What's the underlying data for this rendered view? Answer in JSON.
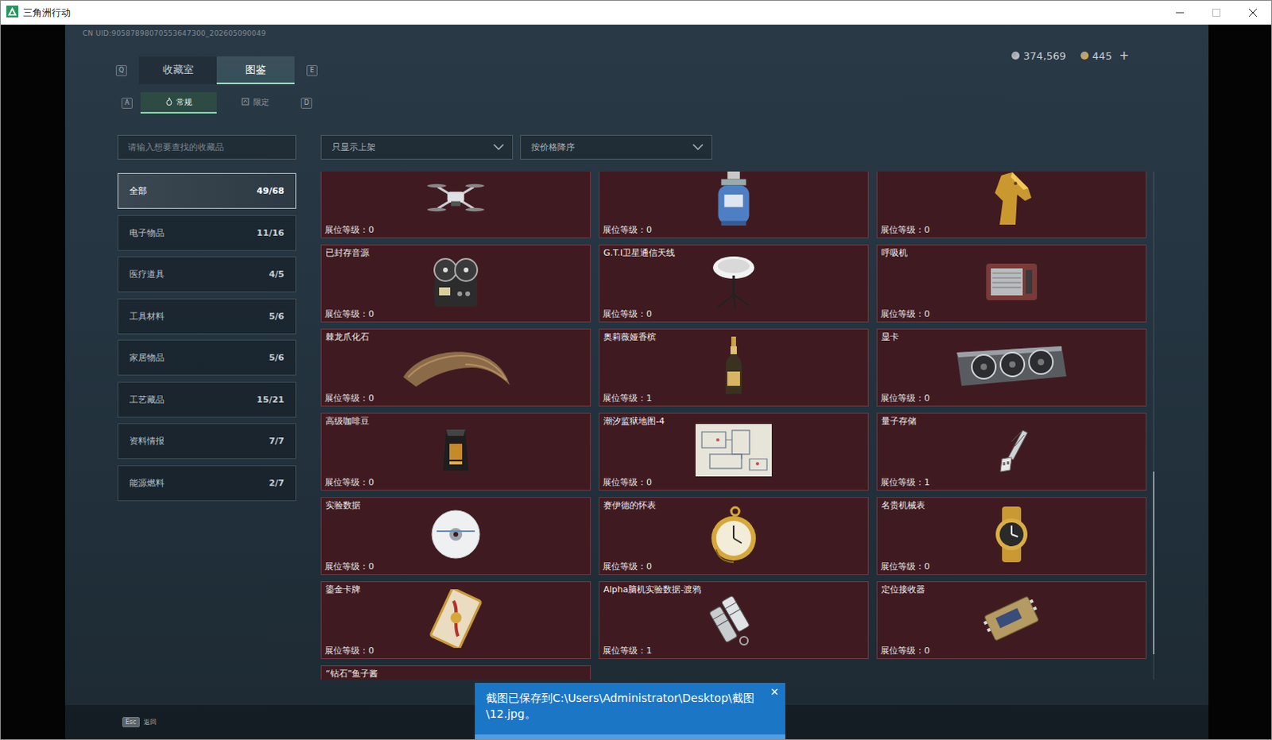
{
  "window": {
    "title": "三角洲行动"
  },
  "uid": "CN UID:90587898070553647300_202605090049",
  "currency": [
    {
      "amount": "374,569",
      "color": "#b9bec2"
    },
    {
      "amount": "445",
      "color": "#d8a444"
    }
  ],
  "currency_add": "+",
  "tabs": {
    "prev_key": "Q",
    "next_key": "E",
    "items": [
      {
        "label": "收藏室",
        "selected": false
      },
      {
        "label": "图鉴",
        "selected": true
      }
    ]
  },
  "subtabs": {
    "prev_key": "A",
    "next_key": "D",
    "items": [
      {
        "label": "常规",
        "selected": true
      },
      {
        "label": "限定",
        "selected": false
      }
    ]
  },
  "search": {
    "placeholder": "请输入想要查找的收藏品"
  },
  "filters": [
    {
      "value": "只显示上架"
    },
    {
      "value": "按价格降序"
    }
  ],
  "categories": [
    {
      "label": "全部",
      "count": "49/68",
      "selected": true
    },
    {
      "label": "电子物品",
      "count": "11/16",
      "selected": false
    },
    {
      "label": "医疗道具",
      "count": "4/5",
      "selected": false
    },
    {
      "label": "工具材料",
      "count": "5/6",
      "selected": false
    },
    {
      "label": "家居物品",
      "count": "5/6",
      "selected": false
    },
    {
      "label": "工艺藏品",
      "count": "15/21",
      "selected": false
    },
    {
      "label": "资料情报",
      "count": "7/7",
      "selected": false
    },
    {
      "label": "能源燃料",
      "count": "2/7",
      "selected": false
    }
  ],
  "collectibles": [
    {
      "level_text": "展位等级：0"
    },
    {
      "level_text": "展位等级：0"
    },
    {
      "level_text": "展位等级：0"
    },
    {
      "name": "已封存音源",
      "level_text": "展位等级：0"
    },
    {
      "name": "G.T.I卫星通信天线",
      "level_text": "展位等级：0"
    },
    {
      "name": "呼吸机",
      "level_text": "展位等级：0"
    },
    {
      "name": "棘龙爪化石",
      "level_text": "展位等级：0"
    },
    {
      "name": "奥莉薇娅香槟",
      "level_text": "展位等级：1"
    },
    {
      "name": "显卡",
      "level_text": "展位等级：0"
    },
    {
      "name": "高级咖啡豆",
      "level_text": "展位等级：0"
    },
    {
      "name": "潮汐监狱地图-4",
      "level_text": "展位等级：0"
    },
    {
      "name": "量子存储",
      "level_text": "展位等级：1"
    },
    {
      "name": "实验数据",
      "level_text": "展位等级：0"
    },
    {
      "name": "赛伊德的怀表",
      "level_text": "展位等级：0"
    },
    {
      "name": "名贵机械表",
      "level_text": "展位等级：0"
    },
    {
      "name": "鎏金卡牌",
      "level_text": "展位等级：0"
    },
    {
      "name": "Alpha脑机实验数据-渡鸦",
      "level_text": "展位等级：1"
    },
    {
      "name": "定位接收器",
      "level_text": "展位等级：0"
    },
    {
      "name": "“钻石”鱼子酱"
    }
  ],
  "scrollbar": {
    "thumb_start": 0.59,
    "thumb_share": 0.36
  },
  "toast": {
    "message": "截图已保存到C:\\Users\\Administrator\\Desktop\\截图\\12.jpg。",
    "close": "✕"
  },
  "footer": {
    "key": "Esc",
    "label": "返回"
  }
}
